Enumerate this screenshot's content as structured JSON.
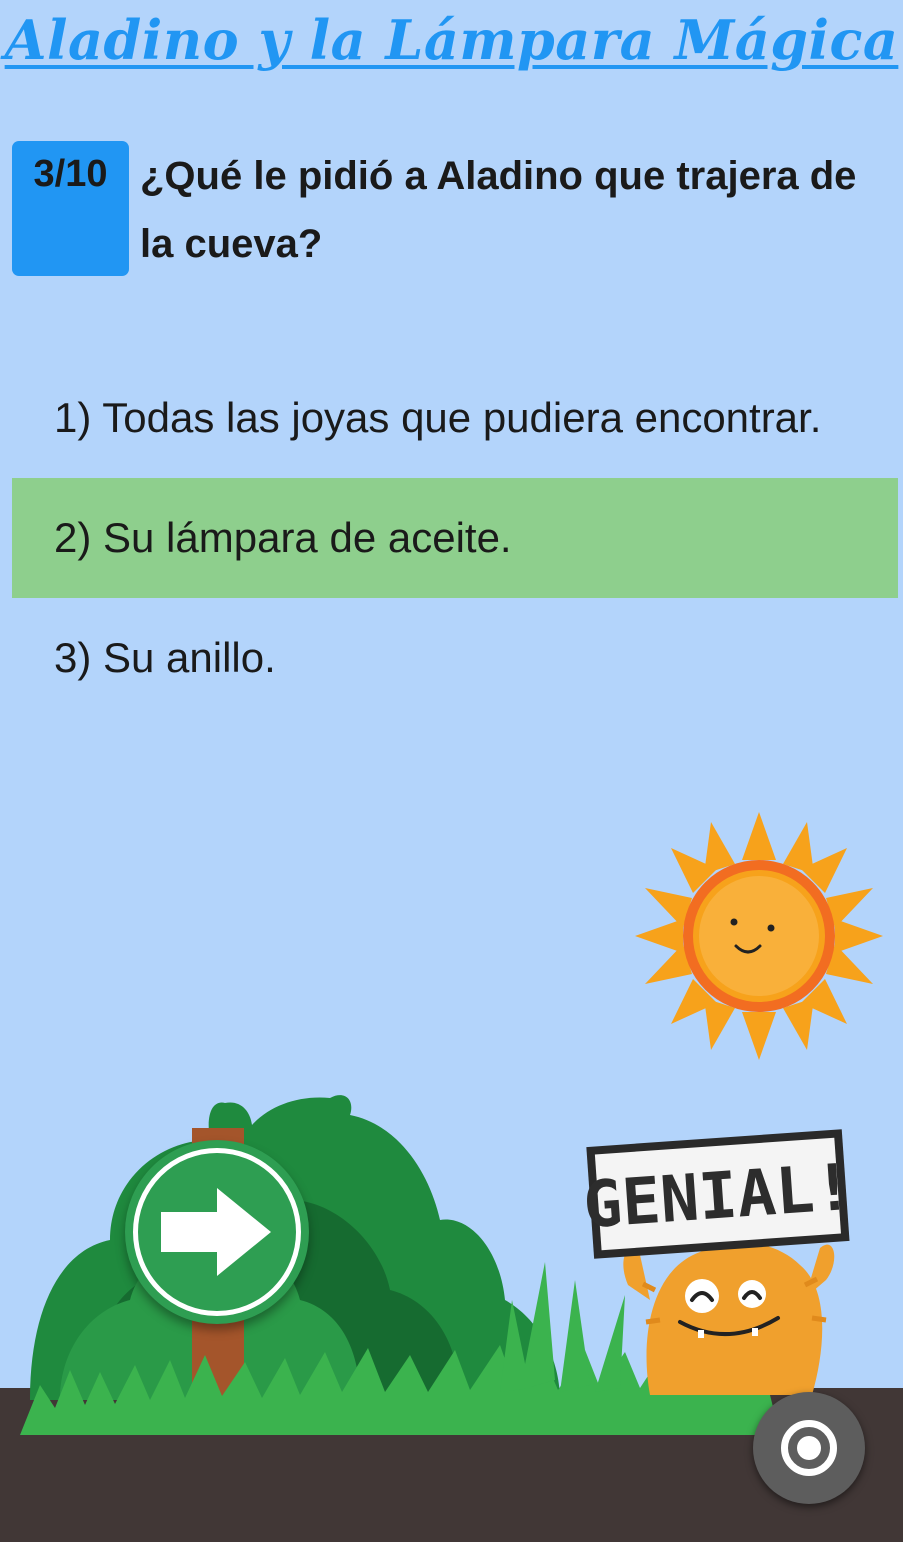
{
  "header": {
    "title": "Aladino y la Lámpara Mágica"
  },
  "quiz": {
    "progress": "3/10",
    "question": "¿Qué le pidió a Aladino que trajera de la cueva?",
    "answers": [
      {
        "label": "1) Todas las joyas que pudiera encontrar.",
        "state": "normal"
      },
      {
        "label": "2) Su lámpara de aceite.",
        "state": "correct"
      },
      {
        "label": "3) Su anillo.",
        "state": "normal"
      }
    ],
    "feedback_sign": "GENIAL!"
  },
  "controls": {
    "next_icon": "arrow-right-icon",
    "record_icon": "record-icon"
  },
  "colors": {
    "background": "#b3d4fb",
    "accent": "#2196f3",
    "correct": "#8ecf8d",
    "ground": "#413736",
    "next_button": "#2e9e52"
  }
}
